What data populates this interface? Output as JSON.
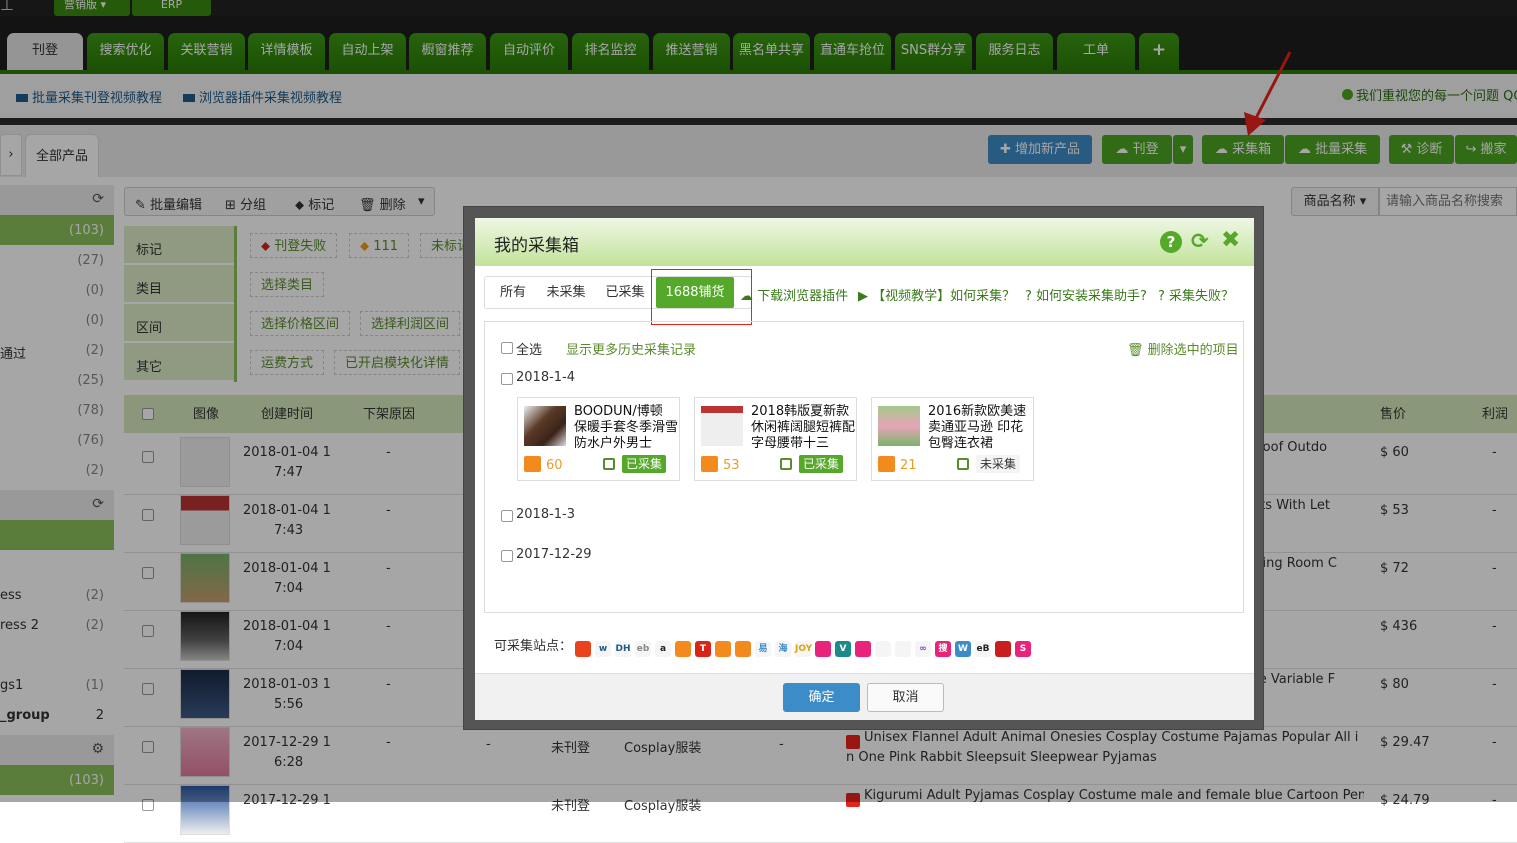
{
  "topbar": {
    "edition": "营销版 ▾",
    "erp": "ERP"
  },
  "tabs": [
    "刊登",
    "搜索优化",
    "关联营销",
    "详情模板",
    "自动上架",
    "橱窗推荐",
    "自动评价",
    "排名监控",
    "推送营销",
    "黑名单共享",
    "直通车抢位",
    "SNS群分享",
    "服务日志",
    "工单",
    "+"
  ],
  "links": {
    "batch_video": "批量采集刊登视频教程",
    "plugin_video": "浏览器插件采集视频教程",
    "right_text": "我们重视您的每一个问题 QQ"
  },
  "toolbar": {
    "breadcrumb_arrow": "›",
    "all_products": "全部产品",
    "add_product": "增加新产品",
    "publish": "刊登",
    "collect_box": "采集箱",
    "batch_collect": "批量采集",
    "diagnose": "诊断",
    "move": "搬家"
  },
  "actions": {
    "batch_edit": "批量编辑",
    "group": "分组",
    "mark": "标记",
    "delete": "删除"
  },
  "search": {
    "field": "商品名称 ▾",
    "placeholder": "请输入商品名称搜索"
  },
  "sidebar": {
    "counts": [
      "(103)",
      "(27)",
      "(0)",
      "(0)",
      "(2)",
      "(25)",
      "(78)",
      "(76)",
      "(2)"
    ],
    "label_pass": "通过",
    "groups": [
      {
        "label": "ess",
        "count": "(2)"
      },
      {
        "label": "ress 2",
        "count": "(2)"
      },
      {
        "label": "gs1",
        "count": "(1)"
      },
      {
        "label": "_group",
        "count": "2"
      }
    ],
    "bottom_count": "(103)"
  },
  "filters": {
    "mark_label": "标记",
    "mark_chips": [
      "刊登失败",
      "111",
      "未标记"
    ],
    "category_label": "类目",
    "category_chip": "选择类目",
    "range_label": "区间",
    "range_chips": [
      "选择价格区间",
      "选择利润区间"
    ],
    "other_label": "其它",
    "other_chips": [
      "运费方式",
      "已开启模块化详情"
    ]
  },
  "table": {
    "headers": {
      "image": "图像",
      "created": "创建时间",
      "reason": "下架原因",
      "price": "售价",
      "profit": "利润"
    },
    "rows": [
      {
        "date": "2018-01-04 1",
        "time": "7:47",
        "reason": "-",
        "title": "rproof Outdo",
        "title2": "",
        "price": "$ 60",
        "profit": "-"
      },
      {
        "date": "2018-01-04 1",
        "time": "7:43",
        "reason": "-",
        "title": "ants With Let",
        "title2": "",
        "price": "$ 53",
        "profit": "-"
      },
      {
        "date": "2018-01-04 1",
        "time": "7:04",
        "reason": "-",
        "title": "Living Room C",
        "title2": "",
        "price": "$ 72",
        "profit": "-"
      },
      {
        "date": "2018-01-04 1",
        "time": "7:04",
        "reason": "-",
        "title": "",
        "title2": "",
        "price": "$ 436",
        "profit": "-"
      },
      {
        "date": "2018-01-03 1",
        "time": "5:56",
        "reason": "-",
        "title": "ase Variable F",
        "title2": "",
        "price": "$ 80",
        "profit": "-"
      },
      {
        "date": "2017-12-29 1",
        "time": "6:28",
        "reason": "-",
        "extra_dash": "-",
        "status": "未刊登",
        "category": "Cosplay服装",
        "dash2": "-",
        "title": "Unisex  Flannel Adult Animal Onesies Cosplay Costume Pajamas Popular All i",
        "title2": "n One Pink Rabbit Sleepsuit Sleepwear Pyjamas",
        "price": "$ 29.47",
        "profit": "-"
      },
      {
        "date": "2017-12-29 1",
        "time": "",
        "reason": "",
        "status": "未刊登",
        "category": "Cosplay服装",
        "title": "Kigurumi Adult Pyjamas Cosplay Costume male and female blue Cartoon Pen",
        "price": "$ 24.79",
        "profit": "-"
      }
    ]
  },
  "modal": {
    "title": "我的采集箱",
    "tabs": [
      "所有",
      "未采集",
      "已采集",
      "1688铺货"
    ],
    "links": [
      "下载浏览器插件",
      "【视频教学】如何采集？",
      "如何安装采集助手?",
      "采集失败？"
    ],
    "select_all": "全选",
    "history": "显示更多历史采集记录",
    "delete_selected": "删除选中的项目",
    "dates": [
      "2018-1-4",
      "2018-1-3",
      "2017-12-29"
    ],
    "cards": [
      {
        "title": "BOODUN/博顿 保暖手套冬季滑雪防水户外男士",
        "count": "60",
        "status": "已采集",
        "collected": true
      },
      {
        "title": "2018韩版夏新款休闲裤阔腿短裤配字母腰带十三",
        "count": "53",
        "status": "已采集",
        "collected": true
      },
      {
        "title": "2016新款欧美速卖通亚马逊 印花包臀连衣裙",
        "count": "21",
        "status": "未采集",
        "collected": false
      }
    ],
    "sites_label": "可采集站点：",
    "confirm": "确定",
    "cancel": "取消"
  }
}
